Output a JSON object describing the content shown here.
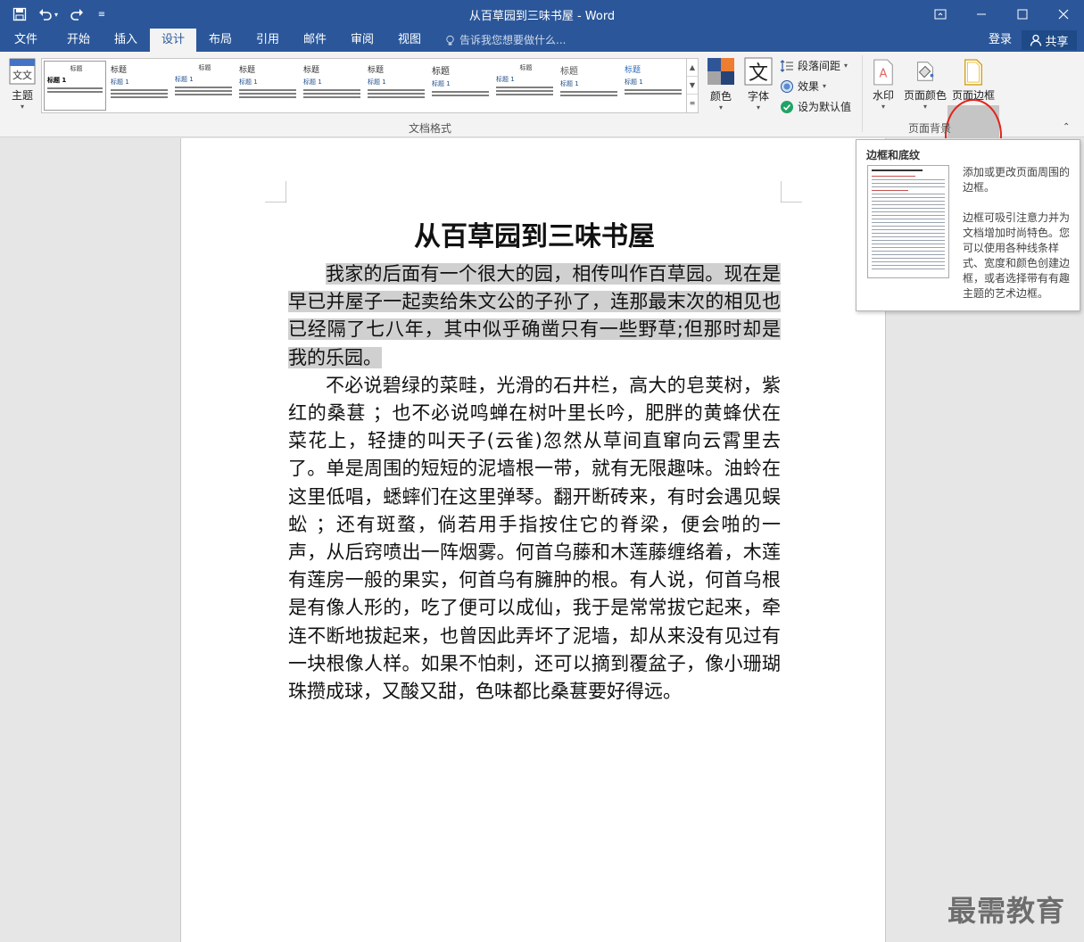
{
  "window": {
    "title": "从百草园到三味书屋 - Word"
  },
  "tabs": [
    {
      "label": "文件"
    },
    {
      "label": "开始"
    },
    {
      "label": "插入"
    },
    {
      "label": "设计"
    },
    {
      "label": "布局"
    },
    {
      "label": "引用"
    },
    {
      "label": "邮件"
    },
    {
      "label": "审阅"
    },
    {
      "label": "视图"
    }
  ],
  "tell_me": "告诉我您想要做什么...",
  "account": {
    "login": "登录",
    "share": "共享"
  },
  "ribbon": {
    "theme": "主题",
    "gallery_items": [
      {
        "title": "标题",
        "head": "标题 1"
      },
      {
        "title": "标题",
        "head": "标题 1"
      },
      {
        "title": "标题",
        "head": "标题 1"
      },
      {
        "title": "标题",
        "head": "标题 1"
      },
      {
        "title": "标题",
        "head": "标题 1"
      },
      {
        "title": "标题",
        "head": "标题 1"
      },
      {
        "title": "标题",
        "head": "标题 1"
      },
      {
        "title": "标题",
        "head": "标题 1"
      },
      {
        "title": "标题",
        "head": "标题 1"
      },
      {
        "title": "标题",
        "head": "标题 1"
      }
    ],
    "document_format_label": "文档格式",
    "colors": "颜色",
    "fonts": "字体",
    "paragraph_spacing": "段落间距",
    "effects": "效果",
    "set_default": "设为默认值",
    "watermark": "水印",
    "page_color": "页面颜色",
    "page_borders": "页面边框",
    "page_background_label": "页面背景"
  },
  "document": {
    "title": "从百草园到三味书屋",
    "paragraphs": [
      "我家的后面有一个很大的园，相传叫作百草园。现在是早已并屋子一起卖给朱文公的子孙了，连那最末次的相见也已经隔了七八年，其中似乎确凿只有一些野草;但那时却是我的乐园。",
      "不必说碧绿的菜畦，光滑的石井栏，高大的皂荚树，紫红的桑葚 ；也不必说鸣蝉在树叶里长吟，肥胖的黄蜂伏在菜花上，轻捷的叫天子(云雀)忽然从草间直窜向云霄里去了。单是周围的短短的泥墙根一带，就有无限趣味。油蛉在这里低唱，蟋蟀们在这里弹琴。翻开断砖来，有时会遇见蜈蚣 ；还有斑蝥，倘若用手指按住它的脊梁，便会啪的一声，从后窍喷出一阵烟雾。何首乌藤和木莲藤缠络着，木莲有莲房一般的果实，何首乌有臃肿的根。有人说，何首乌根是有像人形的，吃了便可以成仙，我于是常常拔它起来，牵连不断地拔起来，也曾因此弄坏了泥墙，却从来没有见过有一块根像人样。如果不怕刺，还可以摘到覆盆子，像小珊瑚珠攒成球，又酸又甜，色味都比桑葚要好得远。"
    ]
  },
  "tooltip": {
    "title": "边框和底纹",
    "desc1": "添加或更改页面周围的边框。",
    "desc2": "边框可吸引注意力并为文档增加时尚特色。您可以使用各种线条样式、宽度和颜色创建边框，或者选择带有有趣主题的艺术边框。"
  },
  "watermark_text": "最需教育",
  "colors": {
    "brand": "#2b579a",
    "highlight_circle": "#e2231a"
  }
}
